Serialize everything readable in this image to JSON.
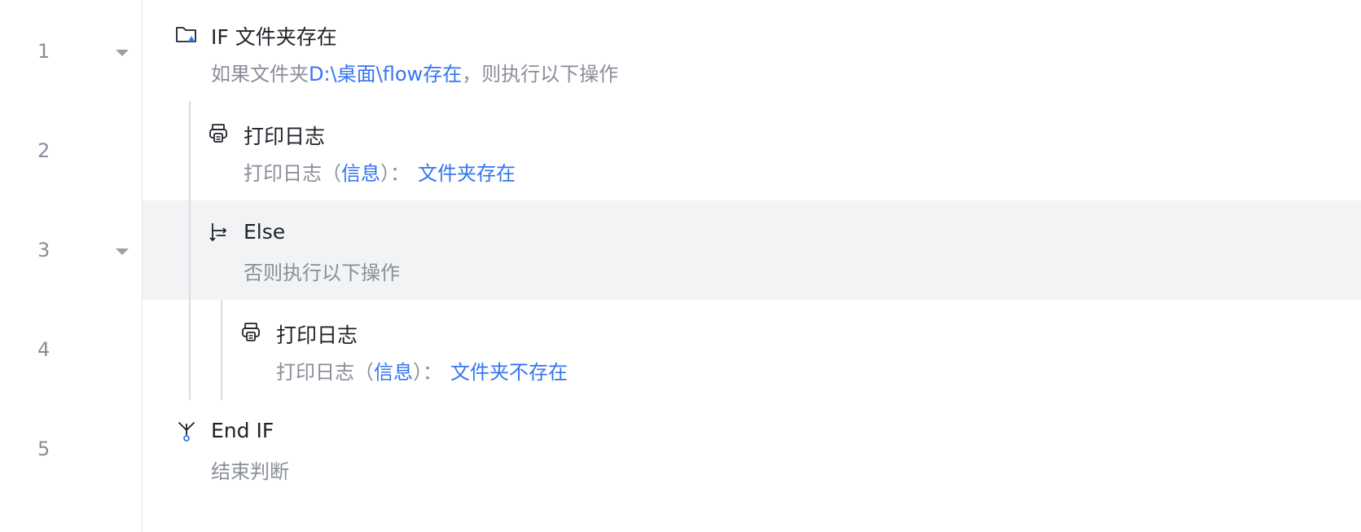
{
  "line_numbers": [
    "1",
    "2",
    "3",
    "4",
    "5"
  ],
  "steps": [
    {
      "icon": "folder-exists-icon",
      "title": "IF 文件夹存在",
      "desc_prefix": "如果文件夹",
      "desc_highlight": "D:\\桌面\\flow存在",
      "desc_suffix": "，则执行以下操作"
    },
    {
      "icon": "print-log-icon",
      "title": "打印日志",
      "desc_prefix": "打印日志（",
      "desc_highlight": "信息",
      "desc_middle": "）：",
      "desc_value": "文件夹存在"
    },
    {
      "icon": "else-branch-icon",
      "title": "Else",
      "desc": "否则执行以下操作"
    },
    {
      "icon": "print-log-icon",
      "title": "打印日志",
      "desc_prefix": "打印日志（",
      "desc_highlight": "信息",
      "desc_middle": "）：",
      "desc_value": "文件夹不存在"
    },
    {
      "icon": "end-if-icon",
      "title": "End IF",
      "desc": "结束判断"
    }
  ],
  "colors": {
    "accent": "#3574f0",
    "text": "#1f2329",
    "muted": "#8a8e99",
    "highlight_row": "#f2f3f5"
  }
}
